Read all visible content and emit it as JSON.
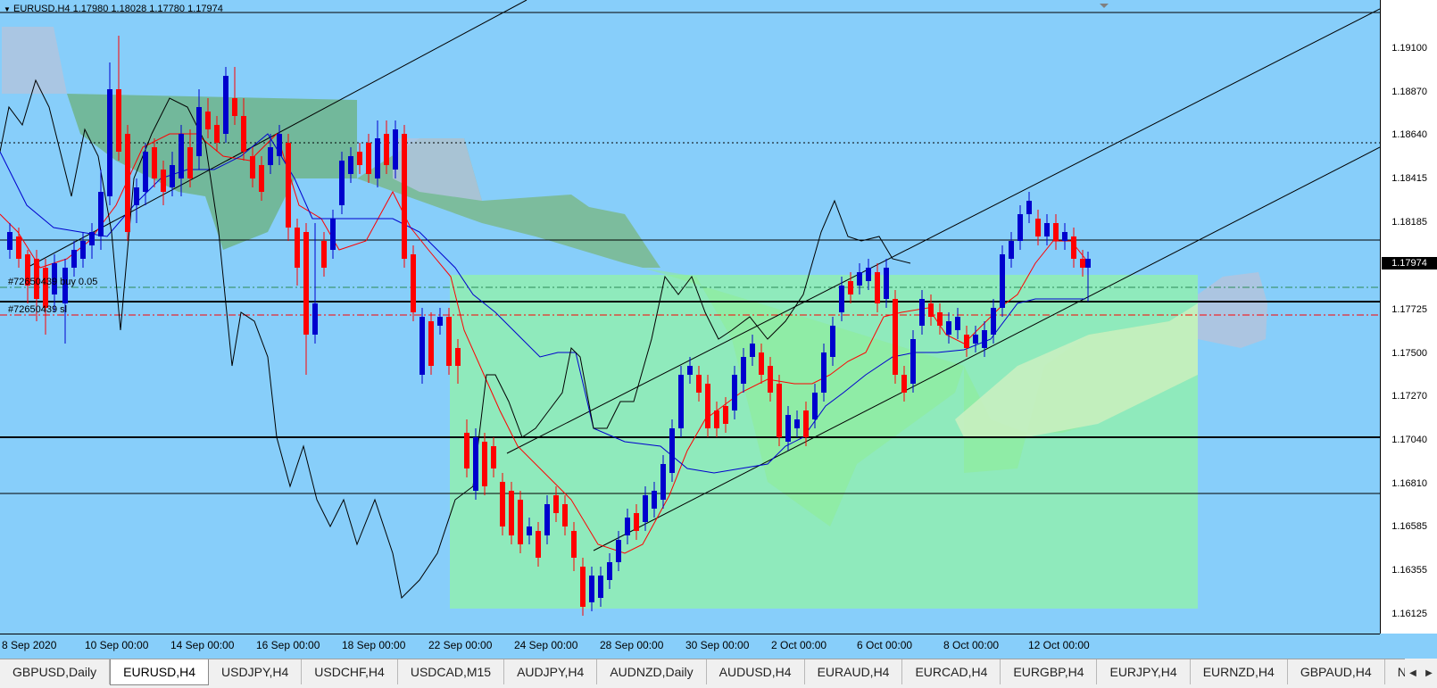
{
  "header": {
    "symbol": "EURUSD,H4",
    "ohlc": "1.17980 1.18028 1.17780 1.17974"
  },
  "price_axis": {
    "labels": [
      "1.19100",
      "1.18870",
      "1.18640",
      "1.18415",
      "1.18185",
      "1.17725",
      "1.17500",
      "1.17270",
      "1.17040",
      "1.16810",
      "1.16585",
      "1.16355",
      "1.16125"
    ],
    "current_price": "1.17974"
  },
  "time_axis": {
    "labels": [
      "8 Sep 2020",
      "10 Sep 00:00",
      "14 Sep 00:00",
      "16 Sep 00:00",
      "18 Sep 00:00",
      "22 Sep 00:00",
      "24 Sep 00:00",
      "28 Sep 00:00",
      "30 Sep 00:00",
      "2 Oct 00:00",
      "6 Oct 00:00",
      "8 Oct 00:00",
      "12 Oct 00:00"
    ]
  },
  "orders": {
    "buy_label": "#72650439 buy 0.05",
    "sl_label": "#72650439 sl"
  },
  "tabs": [
    {
      "label": "GBPUSD,Daily",
      "active": false
    },
    {
      "label": "EURUSD,H4",
      "active": true
    },
    {
      "label": "USDJPY,H4",
      "active": false
    },
    {
      "label": "USDCHF,H4",
      "active": false
    },
    {
      "label": "USDCAD,M15",
      "active": false
    },
    {
      "label": "AUDJPY,H4",
      "active": false
    },
    {
      "label": "AUDNZD,Daily",
      "active": false
    },
    {
      "label": "AUDUSD,H4",
      "active": false
    },
    {
      "label": "EURAUD,H4",
      "active": false
    },
    {
      "label": "EURCAD,H4",
      "active": false
    },
    {
      "label": "EURGBP,H4",
      "active": false
    },
    {
      "label": "EURJPY,H4",
      "active": false
    },
    {
      "label": "EURNZD,H4",
      "active": false
    },
    {
      "label": "GBPAUD,H4",
      "active": false
    },
    {
      "label": "NZD",
      "active": false
    }
  ],
  "colors": {
    "background": "#87cefa",
    "bull_candle": "#0000cd",
    "bear_candle": "#ff0000",
    "kumo_bull": "#90ee90",
    "kumo_bear": "#b0c4de"
  }
}
